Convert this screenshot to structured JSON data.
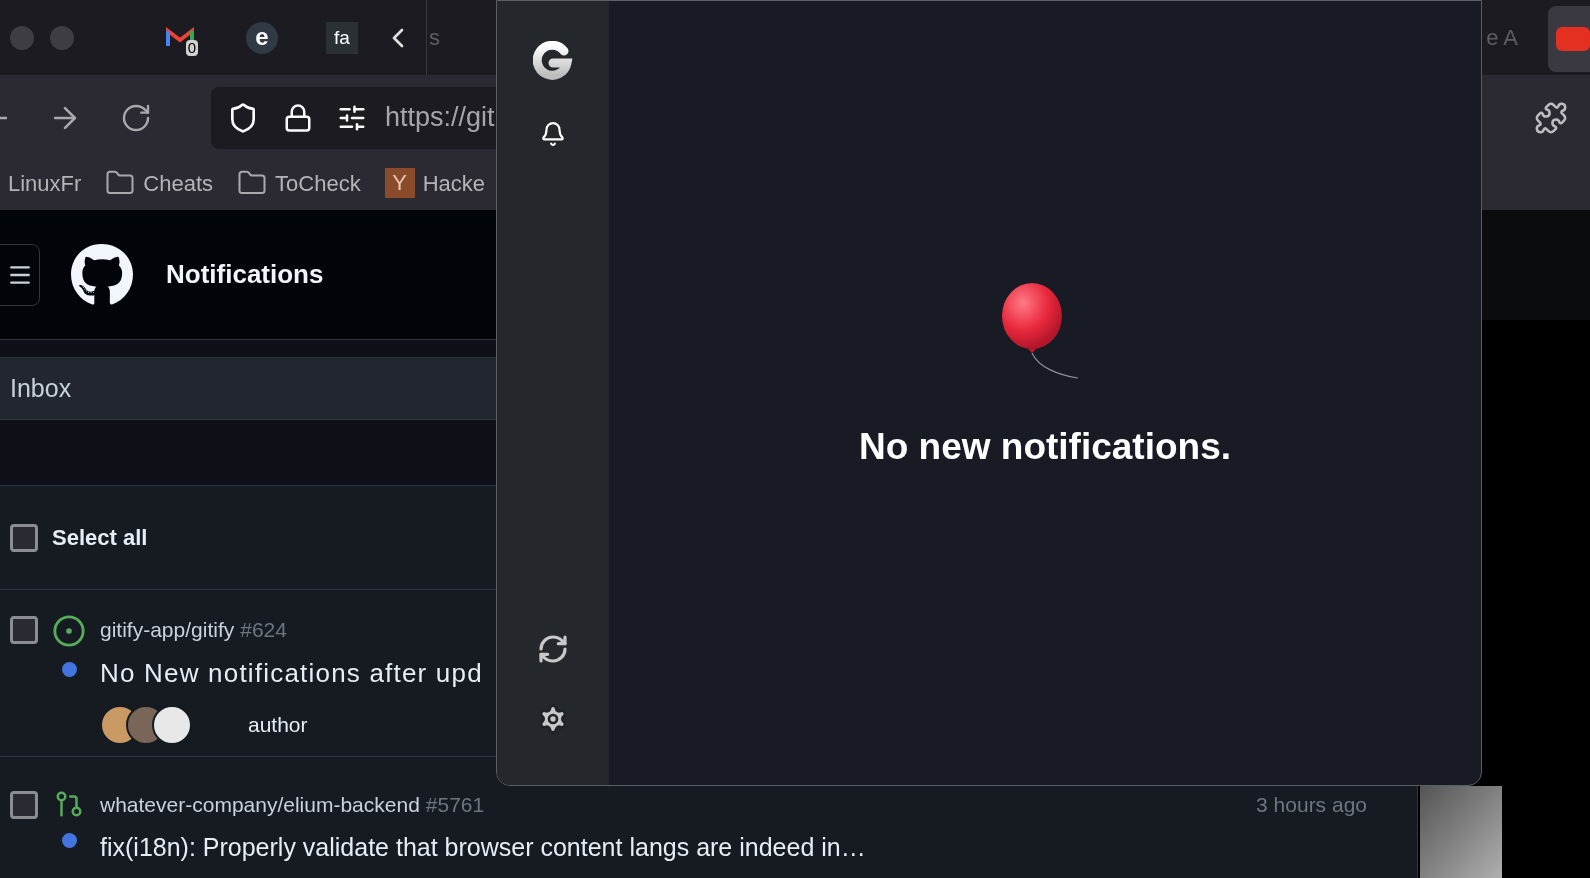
{
  "browser": {
    "pinned_tabs": [
      {
        "kind": "mail",
        "badge": "0"
      },
      {
        "kind": "circle",
        "glyph": "e"
      },
      {
        "kind": "square",
        "glyph": "fa"
      }
    ],
    "tab_titles": [
      "s",
      "e A"
    ],
    "url": "https://git",
    "bookmarks": [
      {
        "kind": "plain",
        "label": "LinuxFr"
      },
      {
        "kind": "folder",
        "label": "Cheats"
      },
      {
        "kind": "folder",
        "label": "ToCheck"
      },
      {
        "kind": "site",
        "glyph": "Y",
        "label": "Hacke"
      }
    ]
  },
  "github": {
    "title": "Notifications",
    "inbox": "Inbox",
    "select_all": {
      "label": "Select all",
      "checked": false
    },
    "notifications": [
      {
        "kind": "issue",
        "repo": "gitify-app/gitify",
        "number": "#624",
        "title": "No New notifications after upd",
        "reason": "author",
        "unread": true,
        "checked": false
      },
      {
        "kind": "pull",
        "repo": "whatever-company/elium-backend",
        "number": "#5761",
        "time": "3 hours ago",
        "title": "fix(i18n): Properly validate that browser content langs are indeed in…",
        "unread": true,
        "checked": false
      }
    ]
  },
  "popup": {
    "message": "No new notifications."
  }
}
